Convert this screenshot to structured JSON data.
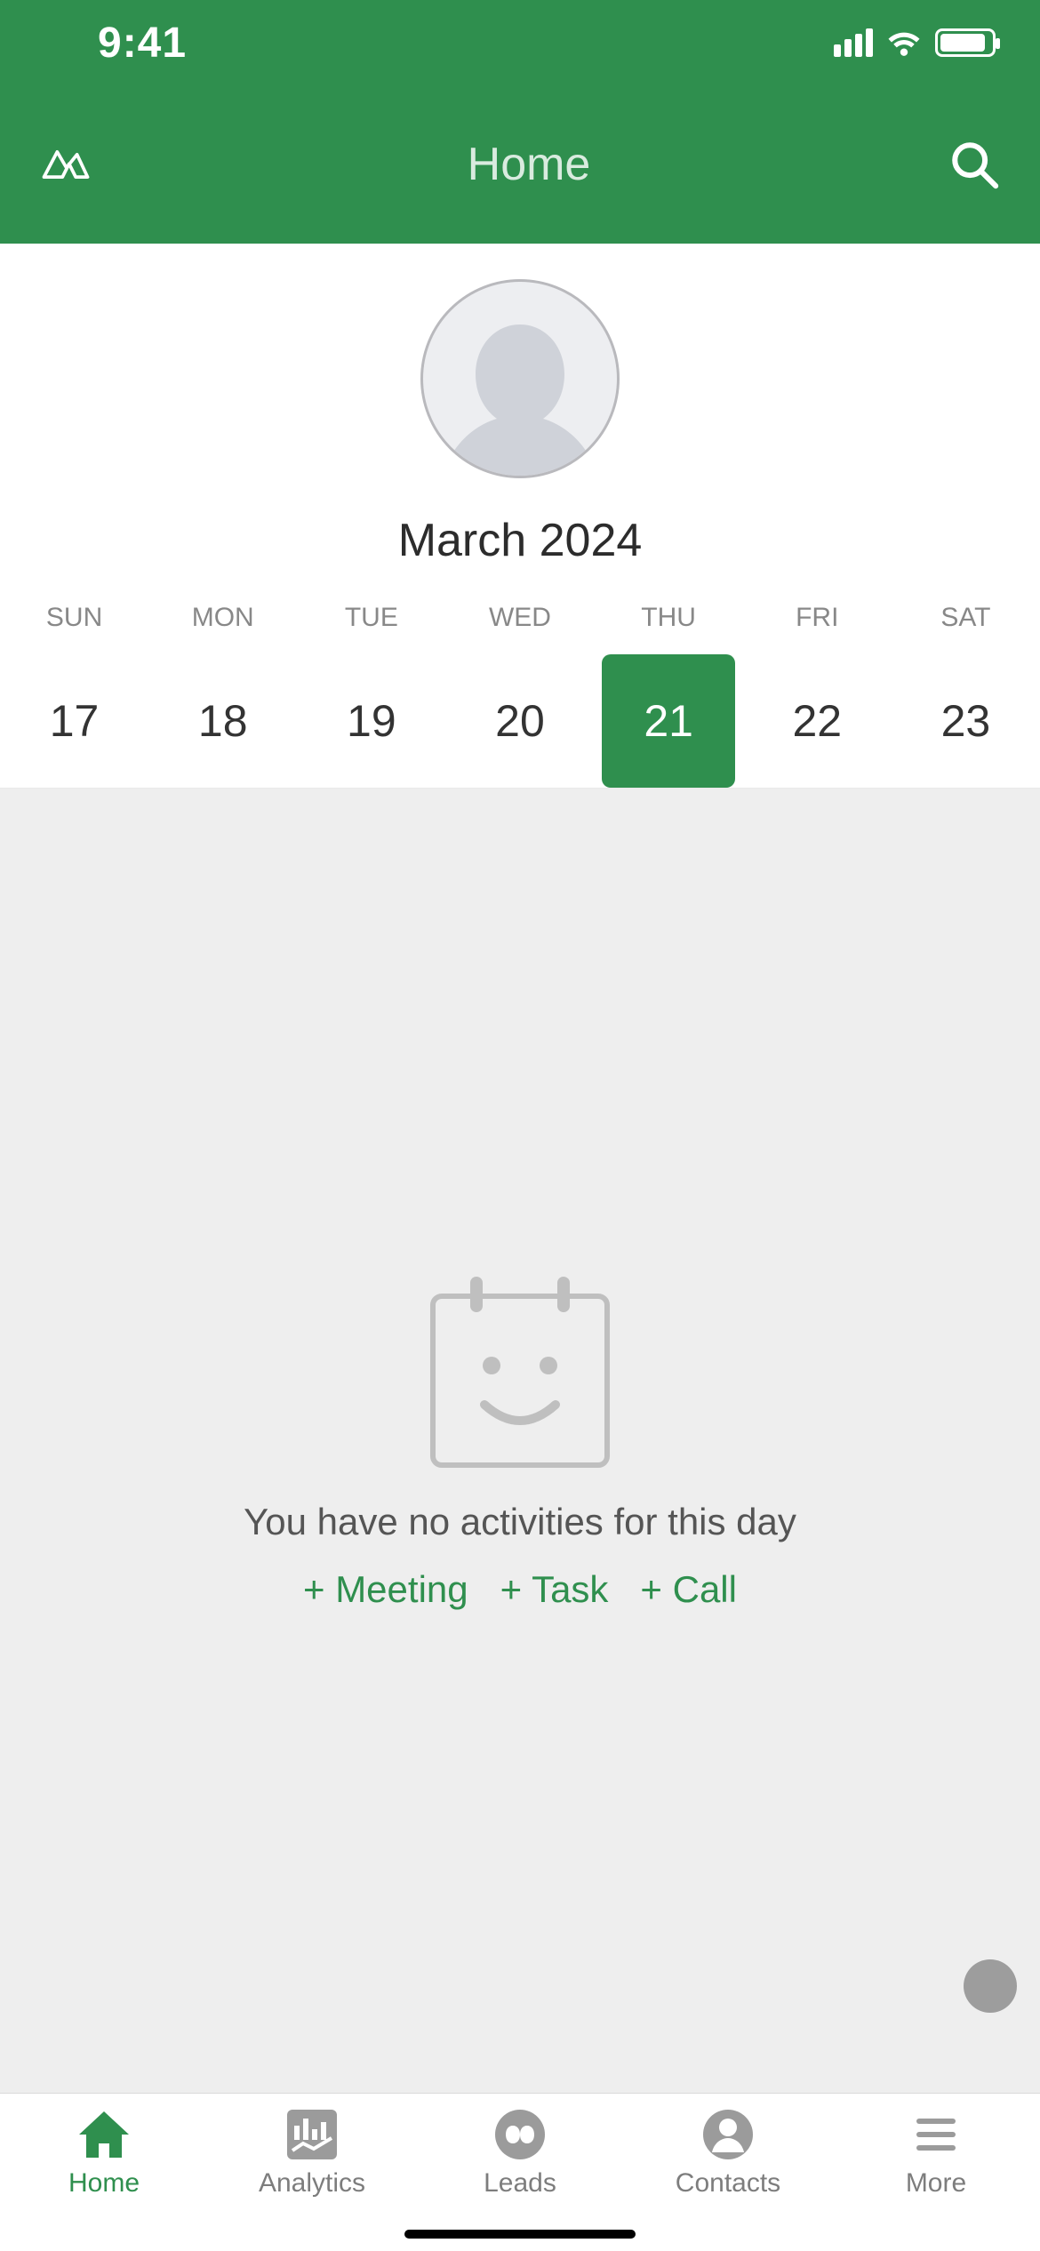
{
  "status": {
    "time": "9:41"
  },
  "nav": {
    "title": "Home"
  },
  "calendar": {
    "month_label": "March 2024",
    "dow": [
      "SUN",
      "MON",
      "TUE",
      "WED",
      "THU",
      "FRI",
      "SAT"
    ],
    "days": [
      "17",
      "18",
      "19",
      "20",
      "21",
      "22",
      "23"
    ],
    "selected_index": 4
  },
  "empty": {
    "message": "You have no activities for this day",
    "actions": [
      "+ Meeting",
      "+ Task",
      "+ Call"
    ]
  },
  "tabs": {
    "items": [
      {
        "label": "Home",
        "icon": "home-icon",
        "active": true
      },
      {
        "label": "Analytics",
        "icon": "analytics-icon",
        "active": false
      },
      {
        "label": "Leads",
        "icon": "leads-icon",
        "active": false
      },
      {
        "label": "Contacts",
        "icon": "contacts-icon",
        "active": false
      },
      {
        "label": "More",
        "icon": "more-icon",
        "active": false
      }
    ]
  },
  "colors": {
    "brand": "#2f8f4e"
  }
}
